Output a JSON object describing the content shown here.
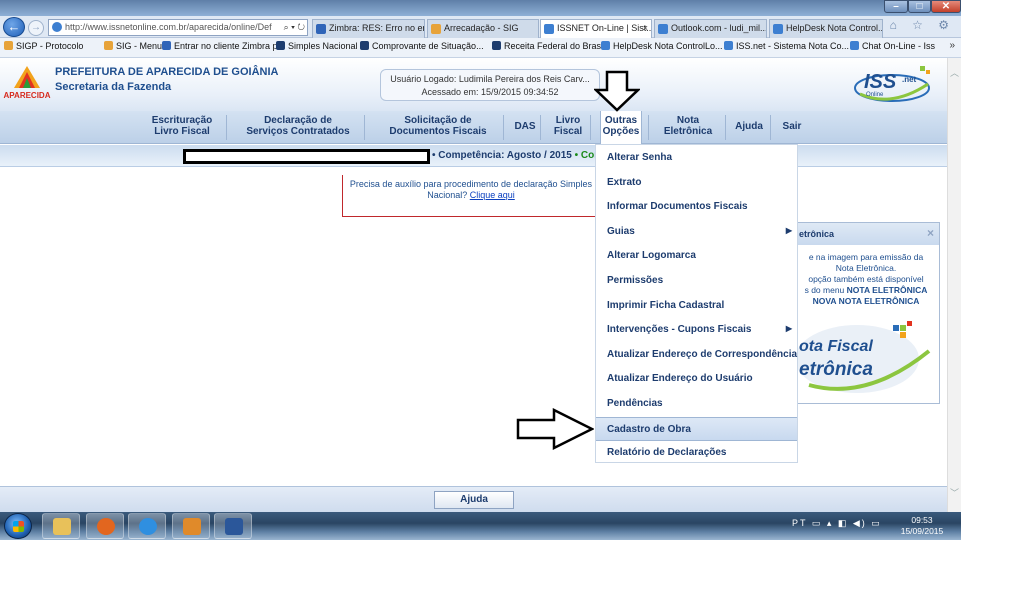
{
  "browser": {
    "address": "http://www.issnetonline.com.br/aparecida/online/Def",
    "address_controls": "⌕ ▾ ↻",
    "tabs": [
      {
        "label": "Zimbra: RES: Erro no en...",
        "color": "#2f64b8"
      },
      {
        "label": "Arrecadação - SIG",
        "color": "#e7a33a"
      },
      {
        "label": "ISSNET On-Line | Sist...",
        "color": "#3d7fd1",
        "active": true
      },
      {
        "label": "Outlook.com - ludi_mil...",
        "color": "#3d7fd1"
      },
      {
        "label": "HelpDesk Nota Control...",
        "color": "#3d7fd1"
      }
    ],
    "tab_close": "×",
    "window_buttons": {
      "minimize": "–",
      "maximize": "□",
      "close": "✕"
    },
    "toolbar_icons": "⌂ ☆ ⚙",
    "favorites": [
      {
        "label": "SIGP - Protocolo",
        "color": "#e7a33a"
      },
      {
        "label": "SIG - Menu",
        "color": "#e7a33a"
      },
      {
        "label": "Entrar no cliente Zimbra p...",
        "color": "#2f64b8"
      },
      {
        "label": "Simples Nacional",
        "color": "#1d3c6e"
      },
      {
        "label": "Comprovante de Situação...",
        "color": "#1d3c6e"
      },
      {
        "label": "Receita Federal do Brasil",
        "color": "#1d3c6e"
      },
      {
        "label": "HelpDesk Nota ControlLo...",
        "color": "#3d7fd1"
      },
      {
        "label": "ISS.net - Sistema Nota Co...",
        "color": "#3d7fd1"
      },
      {
        "label": "Chat On-Line - Iss",
        "color": "#3d7fd1"
      }
    ],
    "favorites_more": "»"
  },
  "header": {
    "org_name": "PREFEITURA DE APARECIDA DE GOIÂNIA",
    "org_sub": "Secretaria da Fazenda",
    "logo_text": "APARECIDA",
    "user_line": "Usuário Logado: Ludimila Pereira dos Reis Carv...",
    "access_line": "Acessado em: 15/9/2015 09:34:52",
    "iss_logo_text": "ISS",
    "iss_logo_sub": "Online",
    "iss_logo_net": ".net"
  },
  "menu": [
    {
      "id": "escrituracao",
      "line1": "Escrituração",
      "line2": "Livro Fiscal"
    },
    {
      "id": "declaracao",
      "line1": "Declaração de",
      "line2": "Serviços Contratados"
    },
    {
      "id": "solicitacao",
      "line1": "Solicitação de",
      "line2": "Documentos Fiscais"
    },
    {
      "id": "das",
      "line1": "DAS",
      "line2": ""
    },
    {
      "id": "livro",
      "line1": "Livro",
      "line2": "Fiscal"
    },
    {
      "id": "outras",
      "line1": "Outras",
      "line2": "Opções"
    },
    {
      "id": "nota",
      "line1": "Nota",
      "line2": "Eletrônica"
    },
    {
      "id": "ajuda",
      "line1": "Ajuda",
      "line2": ""
    },
    {
      "id": "sair",
      "line1": "Sair",
      "line2": ""
    }
  ],
  "competencia": {
    "label": "• Competência: Agosto / 2015",
    "suffix": "• Contr"
  },
  "help_notice": {
    "text": "Precisa de auxílio para procedimento de declaração Simples Nacional?",
    "link": "Clique aqui"
  },
  "dropdown": [
    {
      "label": "Alterar Senha",
      "submenu": false
    },
    {
      "label": "Extrato",
      "submenu": false
    },
    {
      "label": "Informar Documentos Fiscais",
      "submenu": false
    },
    {
      "label": "Guias",
      "submenu": true
    },
    {
      "label": "Alterar Logomarca",
      "submenu": false
    },
    {
      "label": "Permissões",
      "submenu": false
    },
    {
      "label": "Imprimir Ficha Cadastral",
      "submenu": false
    },
    {
      "label": "Intervenções - Cupons Fiscais",
      "submenu": true
    },
    {
      "label": "Atualizar Endereço de Correspondência",
      "submenu": false
    },
    {
      "label": "Atualizar Endereço do Usuário",
      "submenu": false
    },
    {
      "label": "Pendências",
      "submenu": false
    },
    {
      "label": "Cadastro de Obra",
      "submenu": false,
      "selected": true
    },
    {
      "label": "Relatório de Declarações",
      "submenu": false
    }
  ],
  "submenu_arrow": "▶",
  "nota_panel": {
    "title": "etrônica",
    "close": "×",
    "line1": "e na imagem para emissão da",
    "line2": "Nota Eletrônica.",
    "line3": "opção também está disponível",
    "line4_prefix": "s do menu",
    "line4_bold": "NOTA ELETRÔNICA",
    "line5": "NOVA NOTA ELETRÔNICA",
    "graphic_line1": "ota Fiscal",
    "graphic_line2": "etrônica"
  },
  "bottom": {
    "help_button": "Ajuda"
  },
  "scrollbar": {
    "up": "︿",
    "down": "﹀"
  },
  "taskbar": {
    "apps": [
      {
        "name": "explorer",
        "color": "#e8c15a"
      },
      {
        "name": "firefox",
        "color": "#e2661f"
      },
      {
        "name": "internet-explorer",
        "color": "#2f8fe0"
      },
      {
        "name": "media-player",
        "color": "#e08a2a"
      },
      {
        "name": "word",
        "color": "#2b579a"
      }
    ],
    "tray": "PT ▭ ▴ ◧ ◀) ▭",
    "time": "09:53",
    "date": "15/09/2015"
  },
  "colors": {
    "header_text": "#1f4f8f",
    "menu_text": "#1d3c6e",
    "notice_border": "#c0282c",
    "competencia_green": "#1a8a1a"
  }
}
